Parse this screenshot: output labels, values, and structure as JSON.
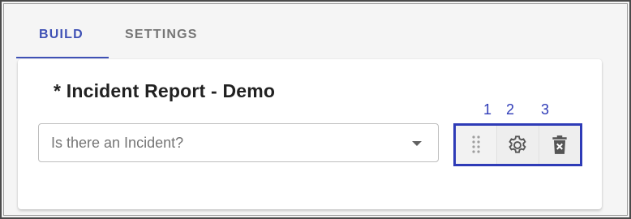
{
  "tabs": [
    {
      "label": "BUILD",
      "active": true
    },
    {
      "label": "SETTINGS",
      "active": false
    }
  ],
  "card": {
    "title": "* Incident Report - Demo",
    "select": {
      "value": "Is there an Incident?"
    }
  },
  "toolbar": {
    "drag_icon": "drag-handle-icon",
    "settings_icon": "gear-icon",
    "delete_icon": "delete-icon"
  },
  "annotations": {
    "one": "1",
    "two": "2",
    "three": "3"
  },
  "colors": {
    "accent": "#3f51b5",
    "highlight_box": "#2e3bb7"
  }
}
